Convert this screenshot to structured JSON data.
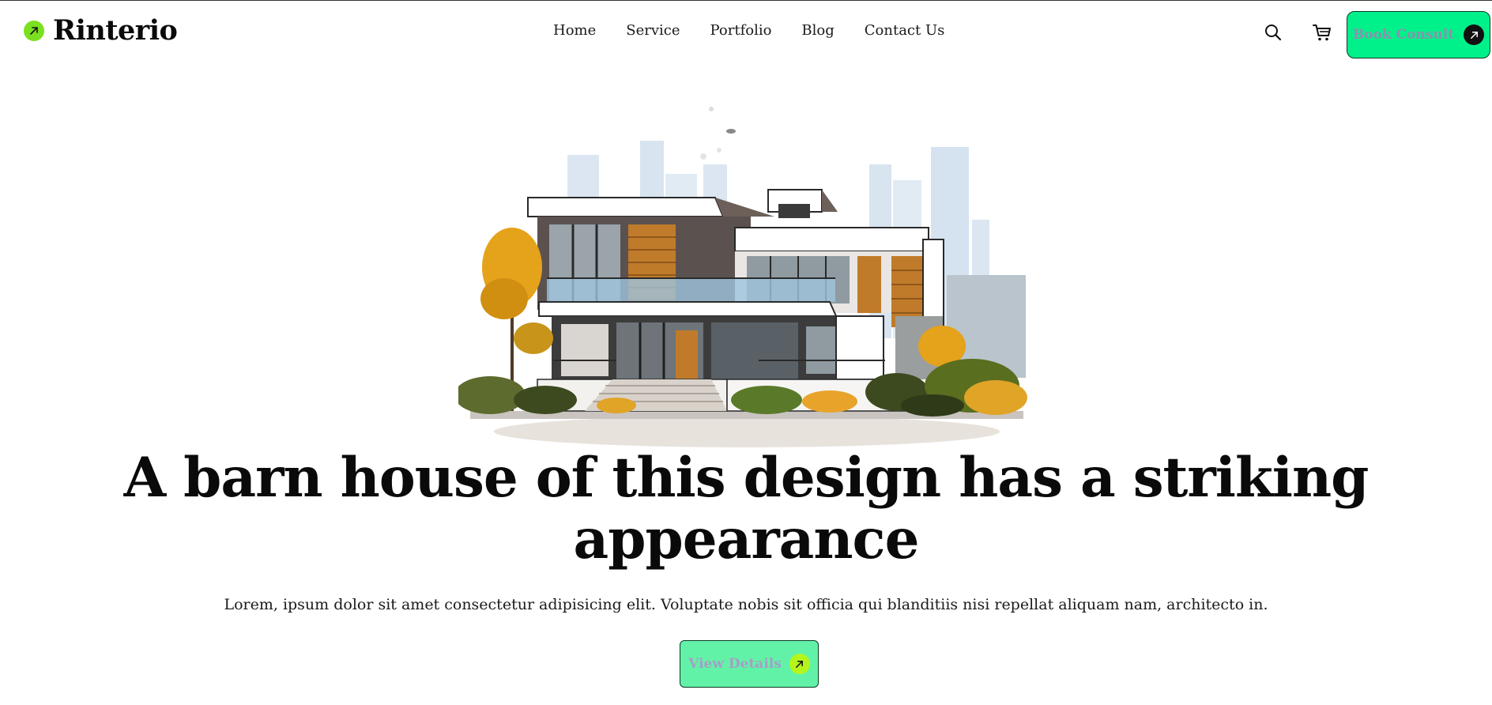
{
  "brand": {
    "name": "Rinterio",
    "accent": "#7be01f"
  },
  "nav": {
    "items": [
      {
        "label": "Home"
      },
      {
        "label": "Service"
      },
      {
        "label": "Portfolio"
      },
      {
        "label": "Blog"
      },
      {
        "label": "Contact Us"
      }
    ]
  },
  "header_actions": {
    "search_icon": "search-icon",
    "cart_icon": "cart-icon",
    "book_button": {
      "label": "Book Consult",
      "icon": "arrow-up-right-icon",
      "color": "#00f08a"
    }
  },
  "hero": {
    "illustration": "modern-house-illustration",
    "title": "A barn house of this design has a striking appearance",
    "description": "Lorem, ipsum dolor sit amet consectetur adipisicing elit. Voluptate nobis sit officia qui blanditiis nisi repellat aliquam nam, architecto in.",
    "cta": {
      "label": "View Details",
      "icon": "arrow-up-right-icon",
      "color": "#62f2a7"
    }
  }
}
